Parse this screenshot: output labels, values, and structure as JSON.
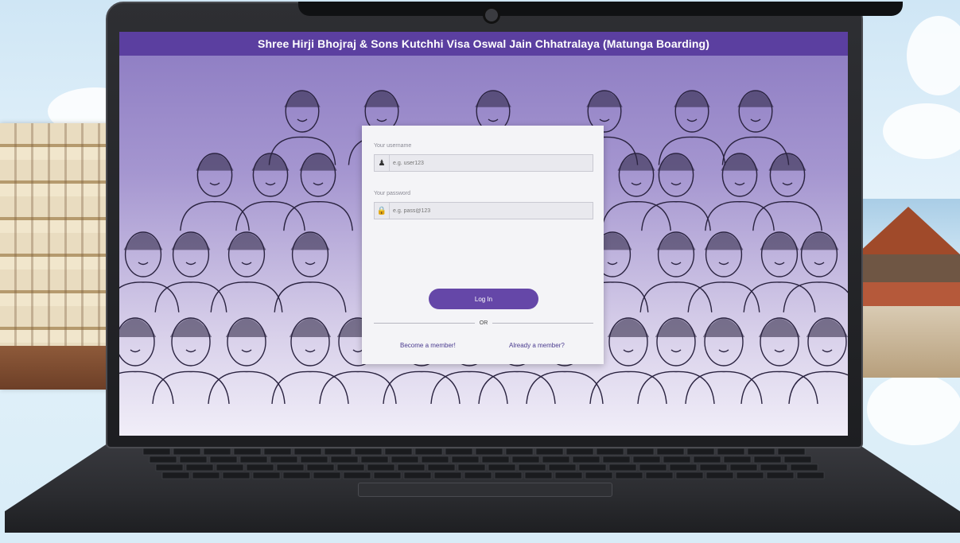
{
  "header": {
    "title": "Shree Hirji Bhojraj & Sons Kutchhi Visa Oswal Jain Chhatralaya (Matunga Boarding)"
  },
  "login": {
    "username_label": "Your username",
    "username_placeholder": "e.g. user123",
    "username_icon": "user-icon",
    "password_label": "Your password",
    "password_placeholder": "e.g. pass@123",
    "password_icon": "lock-icon",
    "login_button": "Log In",
    "separator": "OR",
    "become_member_link": "Become a member!",
    "already_member_link": "Already a member?"
  },
  "colors": {
    "header_bg": "#5b3fa0",
    "button_bg": "#6547a8",
    "link": "#4a3b8f"
  }
}
